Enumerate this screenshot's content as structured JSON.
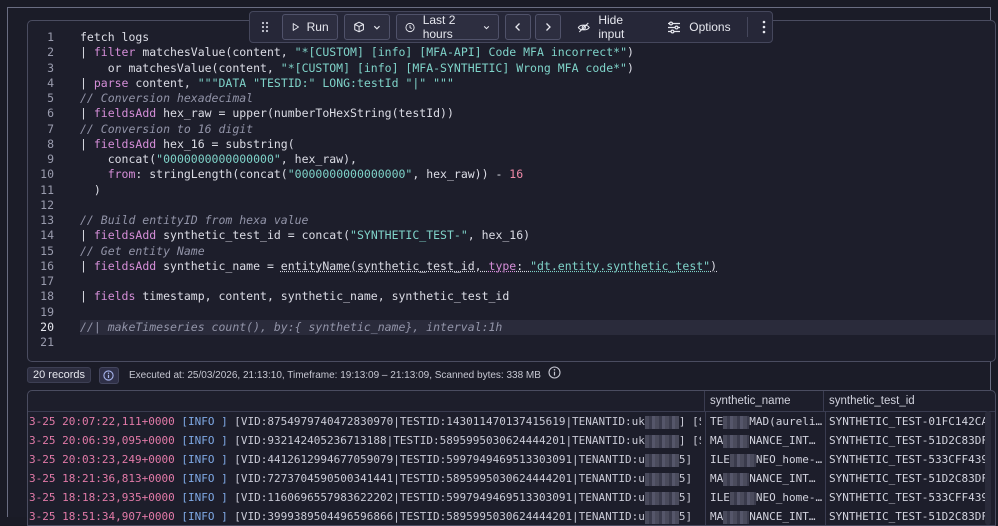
{
  "toolbar": {
    "run_label": "Run",
    "timeframe_label": "Last 2 hours",
    "hide_input_label": "Hide input",
    "options_label": "Options"
  },
  "editor": {
    "active_line": 20,
    "line_numbers": [
      "1",
      "2",
      "3",
      "4",
      "5",
      "6",
      "7",
      "8",
      "9",
      "10",
      "11",
      "12",
      "13",
      "14",
      "15",
      "16",
      "17",
      "18",
      "19",
      "20",
      "21"
    ],
    "lines": [
      [
        {
          "t": "fetch logs",
          "c": ""
        }
      ],
      [
        {
          "t": "| ",
          "c": ""
        },
        {
          "t": "filter",
          "c": "kw"
        },
        {
          "t": " matchesValue(content, ",
          "c": ""
        },
        {
          "t": "\"*[CUSTOM] [info] [MFA-API] Code MFA incorrect*\"",
          "c": "str"
        },
        {
          "t": ")",
          "c": ""
        }
      ],
      [
        {
          "t": "    or matchesValue(content, ",
          "c": ""
        },
        {
          "t": "\"*[CUSTOM] [info] [MFA-SYNTHETIC] Wrong MFA code*\"",
          "c": "str"
        },
        {
          "t": ")",
          "c": ""
        }
      ],
      [
        {
          "t": "| ",
          "c": ""
        },
        {
          "t": "parse",
          "c": "kw"
        },
        {
          "t": " content, ",
          "c": ""
        },
        {
          "t": "\"\"\"DATA \"TESTID:\" LONG:testId \"|\" \"\"\"",
          "c": "str"
        }
      ],
      [
        {
          "t": "// Conversion hexadecimal",
          "c": "cm"
        }
      ],
      [
        {
          "t": "| ",
          "c": ""
        },
        {
          "t": "fieldsAdd",
          "c": "kw"
        },
        {
          "t": " hex_raw = upper(numberToHexString(testId))",
          "c": ""
        }
      ],
      [
        {
          "t": "// Conversion to 16 digit",
          "c": "cm"
        }
      ],
      [
        {
          "t": "| ",
          "c": ""
        },
        {
          "t": "fieldsAdd",
          "c": "kw"
        },
        {
          "t": " hex_16 = substring(",
          "c": ""
        }
      ],
      [
        {
          "t": "    concat(",
          "c": ""
        },
        {
          "t": "\"0000000000000000\"",
          "c": "str"
        },
        {
          "t": ", hex_raw),",
          "c": ""
        }
      ],
      [
        {
          "t": "    ",
          "c": ""
        },
        {
          "t": "from",
          "c": "kw"
        },
        {
          "t": ": stringLength(concat(",
          "c": ""
        },
        {
          "t": "\"0000000000000000\"",
          "c": "str"
        },
        {
          "t": ", hex_raw)) - ",
          "c": ""
        },
        {
          "t": "16",
          "c": "num"
        }
      ],
      [
        {
          "t": "  )",
          "c": ""
        }
      ],
      [
        {
          "t": "",
          "c": ""
        }
      ],
      [
        {
          "t": "// Build entityID from hexa value",
          "c": "cm"
        }
      ],
      [
        {
          "t": "| ",
          "c": ""
        },
        {
          "t": "fieldsAdd",
          "c": "kw"
        },
        {
          "t": " synthetic_test_id = concat(",
          "c": ""
        },
        {
          "t": "\"SYNTHETIC_TEST-\"",
          "c": "str"
        },
        {
          "t": ", hex_16)",
          "c": ""
        }
      ],
      [
        {
          "t": "// Get entity Name",
          "c": "cm"
        }
      ],
      [
        {
          "t": "| ",
          "c": ""
        },
        {
          "t": "fieldsAdd",
          "c": "kw"
        },
        {
          "t": " synthetic_name = ",
          "c": ""
        },
        {
          "t": "entityName(synthetic_test_id, ",
          "c": "ul"
        },
        {
          "t": "type",
          "c": "kw ul"
        },
        {
          "t": ": ",
          "c": "ul"
        },
        {
          "t": "\"dt.entity.synthetic_test\"",
          "c": "str ul"
        },
        {
          "t": ")",
          "c": "ul"
        }
      ],
      [
        {
          "t": "",
          "c": ""
        }
      ],
      [
        {
          "t": "| ",
          "c": ""
        },
        {
          "t": "fields",
          "c": "kw"
        },
        {
          "t": " timestamp, content, synthetic_name, synthetic_test_id",
          "c": ""
        }
      ],
      [
        {
          "t": "",
          "c": ""
        }
      ],
      [
        {
          "t": "//| makeTimeseries count(), by:{ synthetic_name}, interval:1h",
          "c": "cm"
        }
      ],
      [
        {
          "t": "",
          "c": ""
        }
      ]
    ]
  },
  "status": {
    "records_label": "20 records",
    "executed_text": "Executed at: 25/03/2026, 21:13:10, Timeframe: 19:13:09 – 21:13:09, Scanned bytes: 338 MB"
  },
  "table": {
    "columns": [
      "synthetic_name",
      "synthetic_test_id"
    ],
    "rows": [
      {
        "ts": "3-25 20:07:22,111+0000",
        "level": "[INFO ]",
        "body": " [VID:8754979740472830970|TESTID:143011470137415619|TENANTID:uk",
        "tail": "] [S…",
        "name_a": "TE",
        "name_b": "MAD(aureli…",
        "test_id": "SYNTHETIC_TEST-01FC142CA45"
      },
      {
        "ts": "3-25 20:06:39,095+0000",
        "level": "[INFO ]",
        "body": " [VID:932142405236713188|TESTID:5895995030624444201|TENANTID:uk",
        "tail": "] [S…",
        "name_a": "MA",
        "name_b": "NANCE_INT…",
        "test_id": "SYNTHETIC_TEST-51D2C83DF58"
      },
      {
        "ts": "3-25 20:03:23,249+0000",
        "level": "[INFO ]",
        "body": " [VID:4412612994677059079|TESTID:5997949469513303091|TENANTID:u",
        "tail": "5] […",
        "name_a": "ILE",
        "name_b": "NEO_home-…",
        "test_id": "SYNTHETIC_TEST-533CFF43971"
      },
      {
        "ts": "3-25 18:21:36,813+0000",
        "level": "[INFO ]",
        "body": " [VID:7273704590500341441|TESTID:5895995030624444201|TENANTID:u",
        "tail": "5] […",
        "name_a": "MA",
        "name_b": "NANCE_INT…",
        "test_id": "SYNTHETIC_TEST-51D2C83DF58"
      },
      {
        "ts": "3-25 18:18:23,935+0000",
        "level": "[INFO ]",
        "body": " [VID:1160696557983622202|TESTID:5997949469513303091|TENANTID:u",
        "tail": "5] […",
        "name_a": "ILE",
        "name_b": "NEO_home-…",
        "test_id": "SYNTHETIC_TEST-533CFF43971"
      },
      {
        "ts": "3-25 18:51:34,907+0000",
        "level": "[INFO ]",
        "body": " [VID:3999389504496596866|TESTID:5895995030624444201|TENANTID:u",
        "tail": "5] […",
        "name_a": "MA",
        "name_b": "NANCE_INT…",
        "test_id": "SYNTHETIC_TEST-51D2C83DF58"
      }
    ]
  },
  "colors": {
    "keyword": "#d58ed8",
    "string": "#7fd3c9",
    "number": "#f08aa8",
    "timestamp": "#e27aa8",
    "log_level": "#7fa9e6"
  },
  "icons": [
    "drag-handle-icon",
    "play-icon",
    "cube-icon",
    "chevron-down-icon",
    "clock-icon",
    "chevron-left-icon",
    "chevron-right-icon",
    "eye-off-icon",
    "sliders-icon",
    "more-vertical-icon",
    "info-icon"
  ]
}
